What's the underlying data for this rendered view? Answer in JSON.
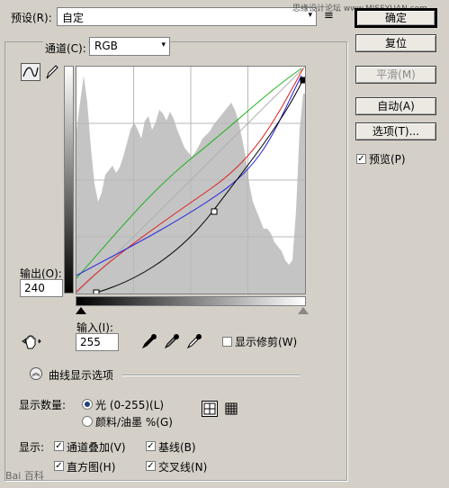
{
  "preset": {
    "label": "预设(R):",
    "value": "自定"
  },
  "watermark": {
    "text": "思缘设计论坛 www.MISSYUAN.com"
  },
  "channel": {
    "label": "通道(C):",
    "value": "RGB"
  },
  "buttons": {
    "ok": "确定",
    "reset": "复位",
    "smooth": "平滑(M)",
    "auto": "自动(A)",
    "options": "选项(T)...",
    "preview": "预览(P)"
  },
  "output": {
    "label": "输出(O):",
    "value": "240"
  },
  "input": {
    "label": "输入(I):",
    "value": "255"
  },
  "show_clipping": "显示修剪(W)",
  "curve_display_options": "曲线显示选项",
  "display_amount": {
    "label": "显示数量:",
    "option_light": "光 (0-255)(L)",
    "option_pigment": "颜料/油墨 %(G)",
    "selected": "light"
  },
  "show": {
    "label": "显示:",
    "channel_overlays": "通道叠加(V)",
    "baseline": "基线(B)",
    "histogram": "直方图(H)",
    "intersection_line": "交叉线(N)"
  },
  "checkboxes": {
    "preview": true,
    "show_clipping": false,
    "channel_overlays": true,
    "baseline": true,
    "histogram": true,
    "intersection_line": true
  },
  "icons": {
    "curve_tool": "curve-point-icon",
    "pencil_tool": "pencil-icon",
    "hand_adjust": "on-image-adjust-hand-icon",
    "eyedropper_black": "black-eyedropper-icon",
    "eyedropper_gray": "gray-eyedropper-icon",
    "eyedropper_white": "white-eyedropper-icon",
    "grid_simple": "grid-4-icon",
    "grid_detailed": "grid-10-icon",
    "collapse": "chevron-up-circle-icon"
  },
  "colors": {
    "curve_rgb": "#000000",
    "curve_red": "#e02020",
    "curve_green": "#20b020",
    "curve_blue": "#2020e0",
    "histogram": "#c4c4c4"
  },
  "baidu": "Bai 百科"
}
